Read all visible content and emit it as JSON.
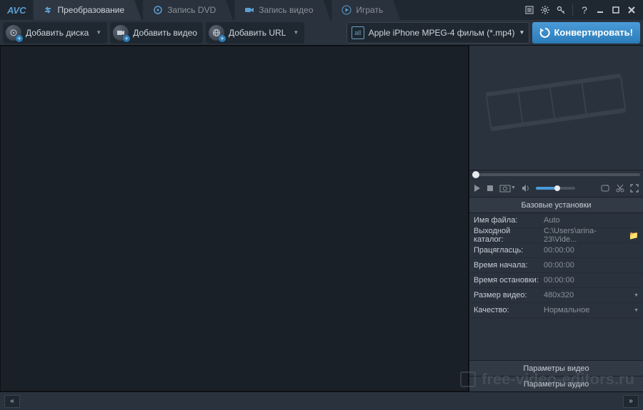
{
  "logo": "AVC",
  "tabs": [
    {
      "label": "Преобразование",
      "active": true
    },
    {
      "label": "Запись DVD",
      "active": false
    },
    {
      "label": "Запись видео",
      "active": false
    },
    {
      "label": "Играть",
      "active": false
    }
  ],
  "toolbar": {
    "add_disc": "Добавить диска",
    "add_video": "Добавить видео",
    "add_url": "Добавить URL",
    "profile_icon": "all",
    "profile": "Apple iPhone MPEG-4 фильм (*.mp4)",
    "convert": "Конвертировать!"
  },
  "settings": {
    "header": "Базовые установки",
    "filename_k": "Имя файла:",
    "filename_v": "Auto",
    "outdir_k": "Выходной каталог:",
    "outdir_v": "C:\\Users\\arina-23\\Vide...",
    "duration_k": "Працягласць:",
    "duration_v": "00:00:00",
    "start_k": "Время начала:",
    "start_v": "00:00:00",
    "stop_k": "Время остановки:",
    "stop_v": "00:00:00",
    "size_k": "Размер видео:",
    "size_v": "480x320",
    "quality_k": "Качество:",
    "quality_v": "Нормальное"
  },
  "params": {
    "video": "Параметры видео",
    "audio": "Параметры аудио"
  },
  "watermark": "free-video-editors.ru"
}
